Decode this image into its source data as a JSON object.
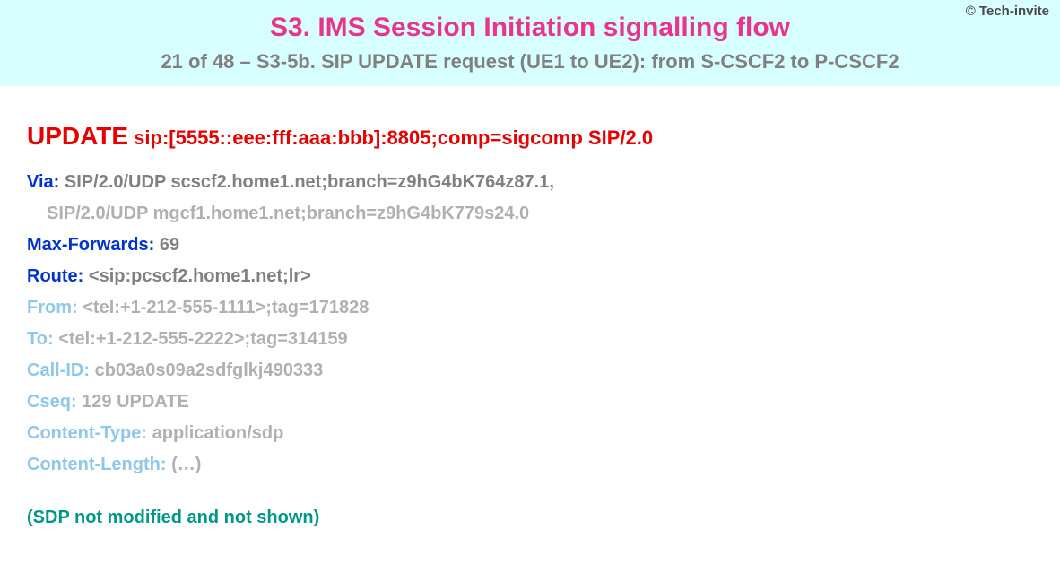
{
  "header": {
    "copyright": "© Tech-invite",
    "title": "S3. IMS Session Initiation signalling flow",
    "subtitle": "21 of 48 – S3-5b. SIP UPDATE request (UE1 to UE2): from S-CSCF2 to P-CSCF2"
  },
  "request": {
    "method": "UPDATE",
    "uri": "sip:[5555::eee:fff:aaa:bbb]:8805;comp=sigcomp SIP/2.0"
  },
  "headers": {
    "via_label": "Via",
    "via_value": "SIP/2.0/UDP scscf2.home1.net;branch=z9hG4bK764z87.1,",
    "via_cont": "SIP/2.0/UDP mgcf1.home1.net;branch=z9hG4bK779s24.0",
    "maxf_label": "Max-Forwards",
    "maxf_value": "69",
    "route_label": "Route",
    "route_value": "<sip:pcscf2.home1.net;lr>",
    "from_label": "From",
    "from_value": "<tel:+1-212-555-1111>;tag=171828",
    "to_label": "To",
    "to_value": "<tel:+1-212-555-2222>;tag=314159",
    "callid_label": "Call-ID",
    "callid_value": "cb03a0s09a2sdfglkj490333",
    "cseq_label": "Cseq",
    "cseq_value": "129 UPDATE",
    "ctype_label": "Content-Type",
    "ctype_value": "application/sdp",
    "clen_label": "Content-Length",
    "clen_value": "(…)"
  },
  "note": "(SDP not modified and not shown)"
}
